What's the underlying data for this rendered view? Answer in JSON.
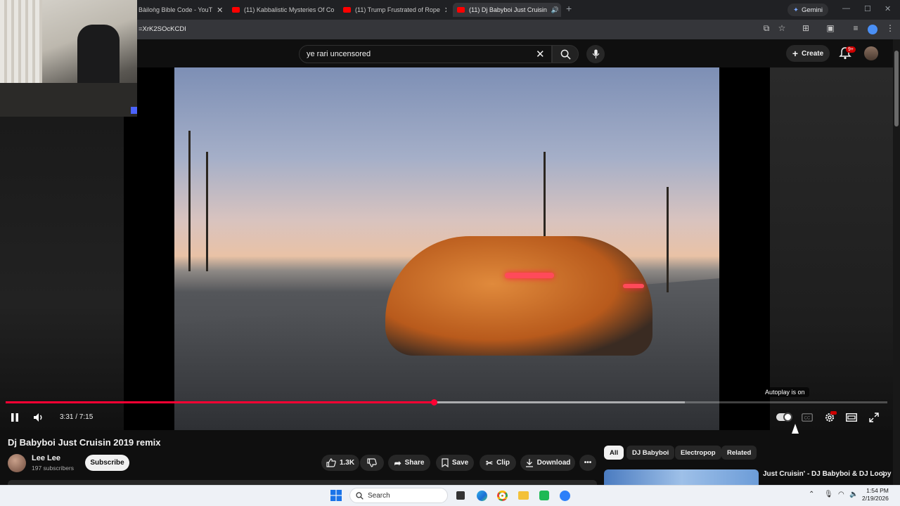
{
  "browser": {
    "tabs": [
      {
        "label": "Bàiloǹg Bible Code - YouT",
        "active": false
      },
      {
        "label": "(11) Kabbalistic Mysteries Of Co",
        "active": false
      },
      {
        "label": "(11) Trump Frustrated of Rope",
        "active": false
      },
      {
        "label": "(11) Dj Babyboi Just Cruisin",
        "active": true
      }
    ],
    "gemini_label": "Gemini",
    "url": "=XrK2SOcKCDI"
  },
  "youtube": {
    "search_value": "ye rari uncensored",
    "create_label": "Create",
    "notification_badge": "9+"
  },
  "player": {
    "current_time": "3:31",
    "duration": "7:15",
    "time_display": "3:31 / 7:15",
    "progress_fraction": 0.486,
    "buffered_fraction": 0.77,
    "autoplay_tooltip": "Autoplay is on"
  },
  "video": {
    "title": "Dj Babyboi Just Cruisin 2019 remix",
    "channel_name": "Lee Lee",
    "subscribers": "197 subscribers",
    "subscribe_label": "Subscribe",
    "like_count": "1.3K",
    "share_label": "Share",
    "save_label": "Save",
    "clip_label": "Clip",
    "download_label": "Download"
  },
  "related": {
    "chips": [
      "All",
      "DJ Babyboi",
      "Electropop",
      "Related"
    ],
    "first_title": "Just Cruisin' - DJ Babyboi & DJ Loopy"
  },
  "taskbar": {
    "search_placeholder": "Search",
    "time": "1:54 PM",
    "date": "2/19/2026"
  },
  "colors": {
    "accent_red": "#ff0033",
    "background": "#0f0f0f"
  }
}
